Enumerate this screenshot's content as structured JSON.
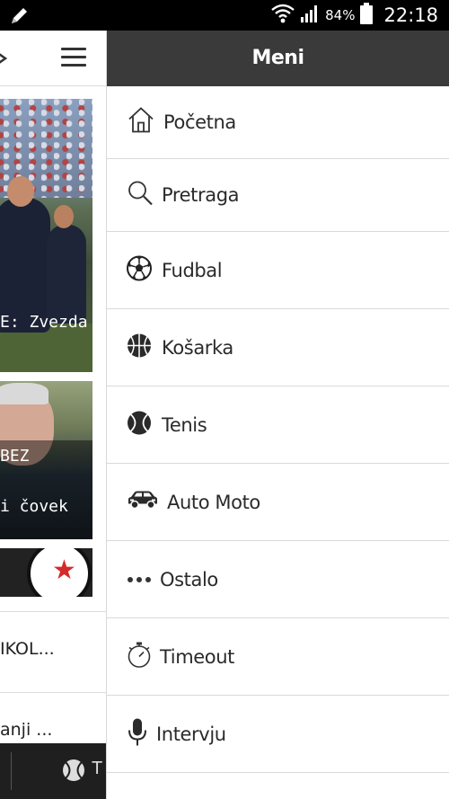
{
  "status_bar": {
    "battery_percent": "84%",
    "time": "22:18"
  },
  "left_panel": {
    "cards": [
      {
        "caption": "E: Zvezda"
      },
      {
        "caption_lines": [
          "BEZ",
          "i čovek"
        ]
      }
    ],
    "list_items": [
      {
        "text": "IKOL..."
      },
      {
        "text": "anji ..."
      }
    ],
    "bottom_bar": {
      "tab_label": "T"
    }
  },
  "drawer": {
    "title": "Meni",
    "items": [
      {
        "label": "Početna",
        "icon": "home-icon"
      },
      {
        "label": "Pretraga",
        "icon": "search-icon"
      },
      {
        "label": "Fudbal",
        "icon": "soccer-ball-icon"
      },
      {
        "label": "Košarka",
        "icon": "basketball-icon"
      },
      {
        "label": "Tenis",
        "icon": "tennis-ball-icon"
      },
      {
        "label": "Auto Moto",
        "icon": "car-icon"
      },
      {
        "label": "Ostalo",
        "icon": "more-dots-icon"
      },
      {
        "label": "Timeout",
        "icon": "stopwatch-icon"
      },
      {
        "label": "Intervju",
        "icon": "microphone-icon"
      }
    ]
  }
}
